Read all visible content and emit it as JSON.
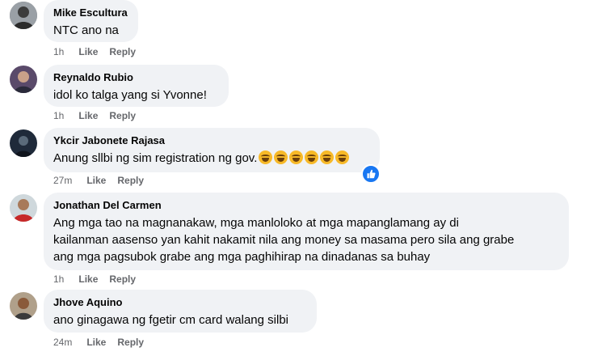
{
  "comments": [
    {
      "name": "Mike Escultura",
      "text": "NTC ano na",
      "time": "1h",
      "like_label": "Like",
      "reply_label": "Reply"
    },
    {
      "name": "Reynaldo Rubio",
      "text": "idol ko talga yang si Yvonne!",
      "time": "1h",
      "like_label": "Like",
      "reply_label": "Reply"
    },
    {
      "name": "Ykcir Jabonete Rajasa",
      "text": "Anung sllbi ng sim registration ng gov.",
      "time": "27m",
      "like_label": "Like",
      "reply_label": "Reply",
      "emojis": [
        "laughing-emoji",
        "laughing-emoji",
        "laughing-emoji",
        "laughing-emoji",
        "laughing-emoji",
        "laughing-emoji"
      ],
      "reaction": "like-icon"
    },
    {
      "name": "Jonathan Del Carmen",
      "text_lines": [
        "Ang mga tao na magnanakaw, mga manloloko at mga mapanglamang ay di",
        "kailanman aasenso yan kahit nakamit nila ang money sa masama pero sila ang grabe",
        "ang mga pagsubok grabe ang mga paghihirap na dinadanas sa buhay"
      ],
      "time": "1h",
      "like_label": "Like",
      "reply_label": "Reply"
    },
    {
      "name": "Jhove Aquino",
      "text": "ano ginagawa ng fgetir cm card walang silbi",
      "time": "24m",
      "like_label": "Like",
      "reply_label": "Reply"
    }
  ],
  "colors": {
    "bubble": "#f0f2f5",
    "meta": "#65676b",
    "like_blue": "#1877f2"
  }
}
